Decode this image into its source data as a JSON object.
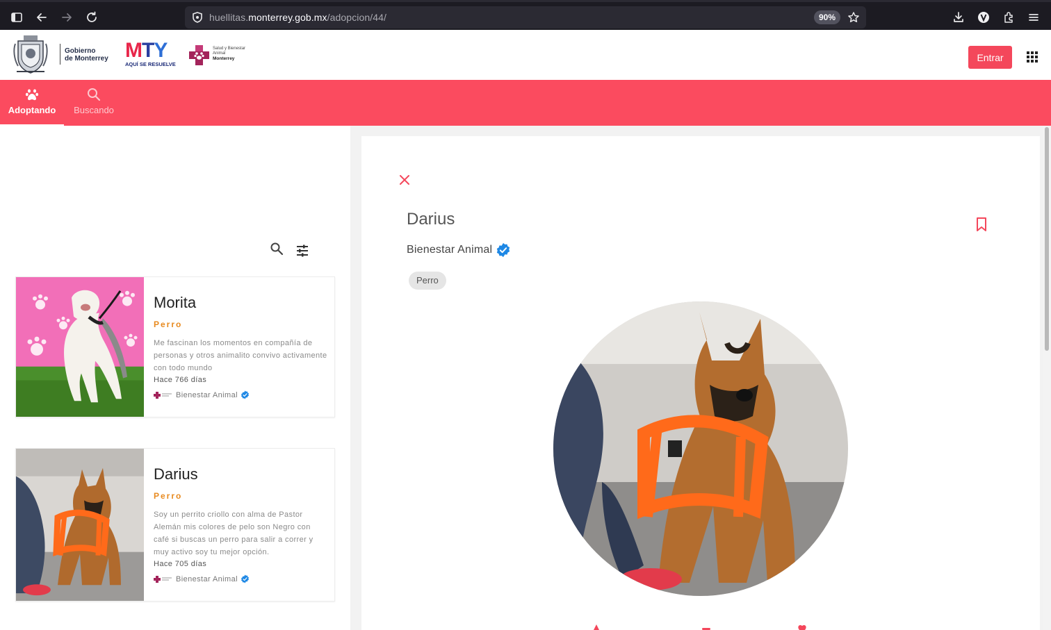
{
  "browser": {
    "url_host": "huellitas.monterrey.gob.mx",
    "url_prefix": "huellitas.",
    "url_domain": "monterrey.gob.mx",
    "url_path": "/adopcion/44/",
    "zoom": "90%"
  },
  "header": {
    "gov_line1": "Gobierno",
    "gov_line2": "de Monterrey",
    "mty_m": "M",
    "mty_t": "T",
    "mty_y": "Y",
    "mty_tagline": "AQUÍ SE RESUELVE",
    "salud_line1": "Salud y Bienestar",
    "salud_line2": "Animal",
    "salud_line3": "Monterrey",
    "login_label": "Entrar"
  },
  "tabs": [
    {
      "label": "Adoptando",
      "icon": "paw-icon",
      "active": true
    },
    {
      "label": "Buscando",
      "icon": "search-icon",
      "active": false
    }
  ],
  "pets": [
    {
      "name": "Morita",
      "type": "Perro",
      "description": "Me fascinan los momentos en compañía de personas y otros animalito convivo activamente con todo mundo",
      "age": "Hace 766 días",
      "org": "Bienestar Animal"
    },
    {
      "name": "Darius",
      "type": "Perro",
      "description": "Soy un perrito criollo con alma de Pastor Alemán mis colores de pelo  son Negro con café si buscas un perro para salir a correr y muy activo soy tu mejor opción.",
      "age": "Hace 705 días",
      "org": "Bienestar Animal"
    }
  ],
  "detail": {
    "name": "Darius",
    "org": "Bienestar Animal",
    "tag": "Perro"
  },
  "colors": {
    "brand": "#fb4b5f",
    "button": "#f4475b",
    "type_label": "#e88a1f",
    "verified": "#1e88e5"
  }
}
